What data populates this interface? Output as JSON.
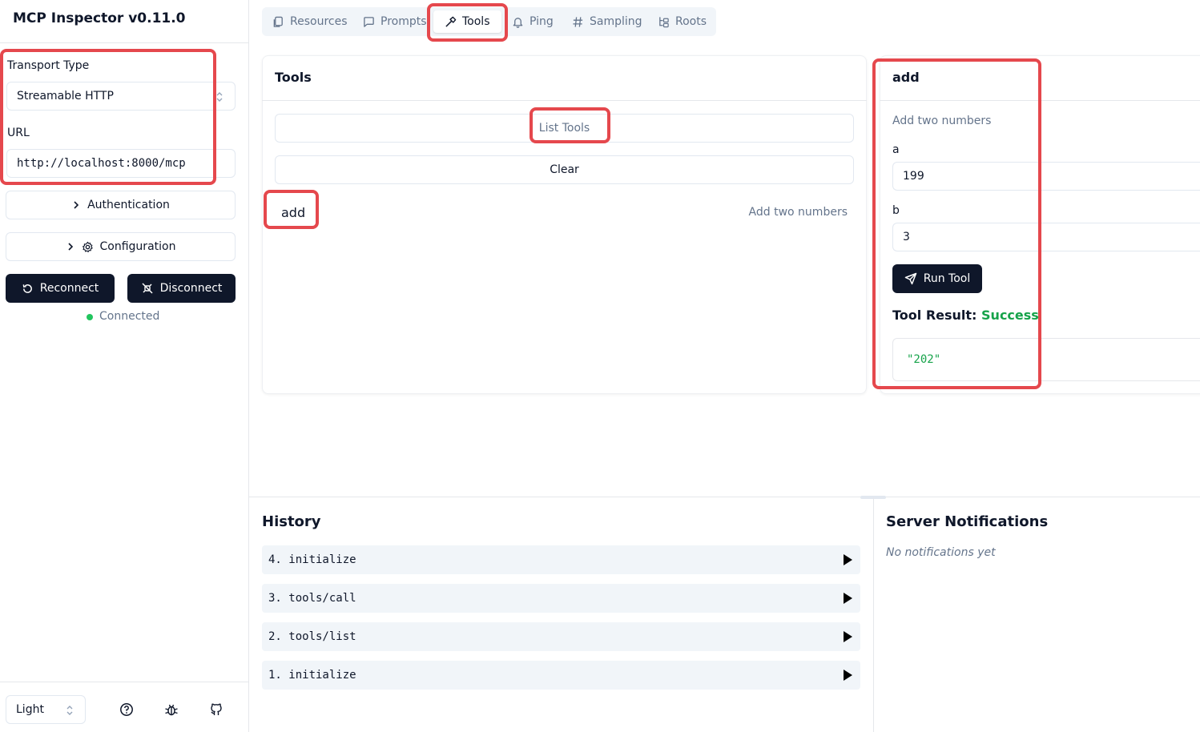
{
  "app": {
    "title": "MCP Inspector v0.11.0"
  },
  "sidebar": {
    "transport_label": "Transport Type",
    "transport_value": "Streamable HTTP",
    "url_label": "URL",
    "url_value": "http://localhost:8000/mcp",
    "auth_label": "Authentication",
    "config_label": "Configuration",
    "reconnect_label": "Reconnect",
    "disconnect_label": "Disconnect",
    "status_text": "Connected",
    "status_color": "#22c55e",
    "theme_value": "Light"
  },
  "tabs": [
    {
      "label": "Resources",
      "icon": "files-icon"
    },
    {
      "label": "Prompts",
      "icon": "message-square-icon"
    },
    {
      "label": "Tools",
      "icon": "hammer-icon",
      "active": true
    },
    {
      "label": "Ping",
      "icon": "bell-icon"
    },
    {
      "label": "Sampling",
      "icon": "hash-icon"
    },
    {
      "label": "Roots",
      "icon": "folder-tree-icon"
    }
  ],
  "tools_panel": {
    "title": "Tools",
    "list_button": "List Tools",
    "clear_button": "Clear",
    "items": [
      {
        "name": "add",
        "description": "Add two numbers"
      }
    ]
  },
  "tool_detail": {
    "title": "add",
    "description": "Add two numbers",
    "param_a_label": "a",
    "param_a_value": "199",
    "param_b_label": "b",
    "param_b_value": "3",
    "run_button": "Run Tool",
    "result_label": "Tool Result:",
    "result_status": "Success",
    "result_value": "\"202\"",
    "success_color": "#16a34a"
  },
  "history": {
    "title": "History",
    "items": [
      "4. initialize",
      "3. tools/call",
      "2. tools/list",
      "1. initialize"
    ]
  },
  "notifications": {
    "title": "Server Notifications",
    "empty_text": "No notifications yet"
  },
  "colors": {
    "highlight": "#e5484d",
    "dark_button": "#0f172a"
  }
}
